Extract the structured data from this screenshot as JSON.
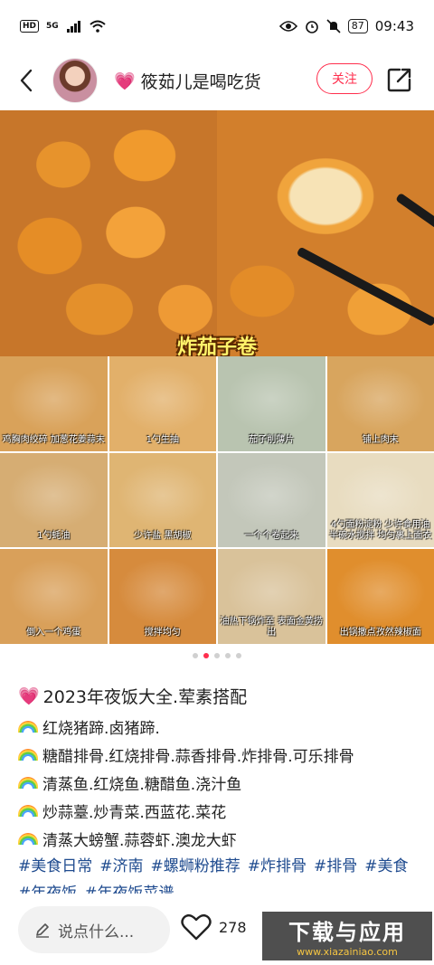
{
  "status_bar": {
    "hd": "HD",
    "network": "5G",
    "battery": "87",
    "time": "09:43"
  },
  "header": {
    "author_name": "筱茹儿是喝吃货",
    "follow_label": "关注"
  },
  "photo": {
    "caption": "炸茄子卷"
  },
  "steps": [
    {
      "label": "鸡胸肉绞碎 加葱花姜蒜末",
      "bg": "#d9a25a"
    },
    {
      "label": "1勺生抽",
      "bg": "#e2b06a"
    },
    {
      "label": "茄子削薄片",
      "bg": "#b9c4b0"
    },
    {
      "label": "铺上肉末",
      "bg": "#d8a55e"
    },
    {
      "label": "1勺蚝油",
      "bg": "#d6ad73"
    },
    {
      "label": "少许盐 黑胡椒",
      "bg": "#dfb573"
    },
    {
      "label": "一个个卷起来",
      "bg": "#c3c7ba"
    },
    {
      "label": "4勺面粉淀粉 少许食用油 半碗水搅拌 均匀裹上面衣",
      "bg": "#e8dcc0"
    },
    {
      "label": "倒入一个鸡蛋",
      "bg": "#d9a05a"
    },
    {
      "label": "搅拌均匀",
      "bg": "#d68b3d"
    },
    {
      "label": "油热下锅炸至 表面金黄捞出",
      "bg": "#d9c29a"
    },
    {
      "label": "出锅撒点孜然辣椒面",
      "bg": "#e08e2d"
    }
  ],
  "carousel": {
    "total": 5,
    "active_index": 1
  },
  "post": {
    "title": "2023年夜饭大全.荤素搭配",
    "lines": [
      "红烧猪蹄.卤猪蹄.",
      "糖醋排骨.红烧排骨.蒜香排骨.炸排骨.可乐排骨",
      "清蒸鱼.红烧鱼.糖醋鱼.浇汁鱼",
      "炒蒜薹.炒青菜.西蓝花.菜花",
      "清蒸大螃蟹.蒜蓉虾.澳龙大虾"
    ],
    "tags": [
      "#美食日常",
      "#济南",
      "#螺蛳粉推荐",
      "#炸排骨",
      "#排骨",
      "#美食",
      "#年夜饭",
      "#年夜饭菜谱"
    ]
  },
  "bottom_bar": {
    "comment_placeholder": "说点什么...",
    "like_count": "278",
    "watermark_main": "下载与应用",
    "watermark_url": "www.xiazainiao.com"
  },
  "colors": {
    "accent": "#ff2e4d",
    "tag": "#1f4b8f"
  }
}
